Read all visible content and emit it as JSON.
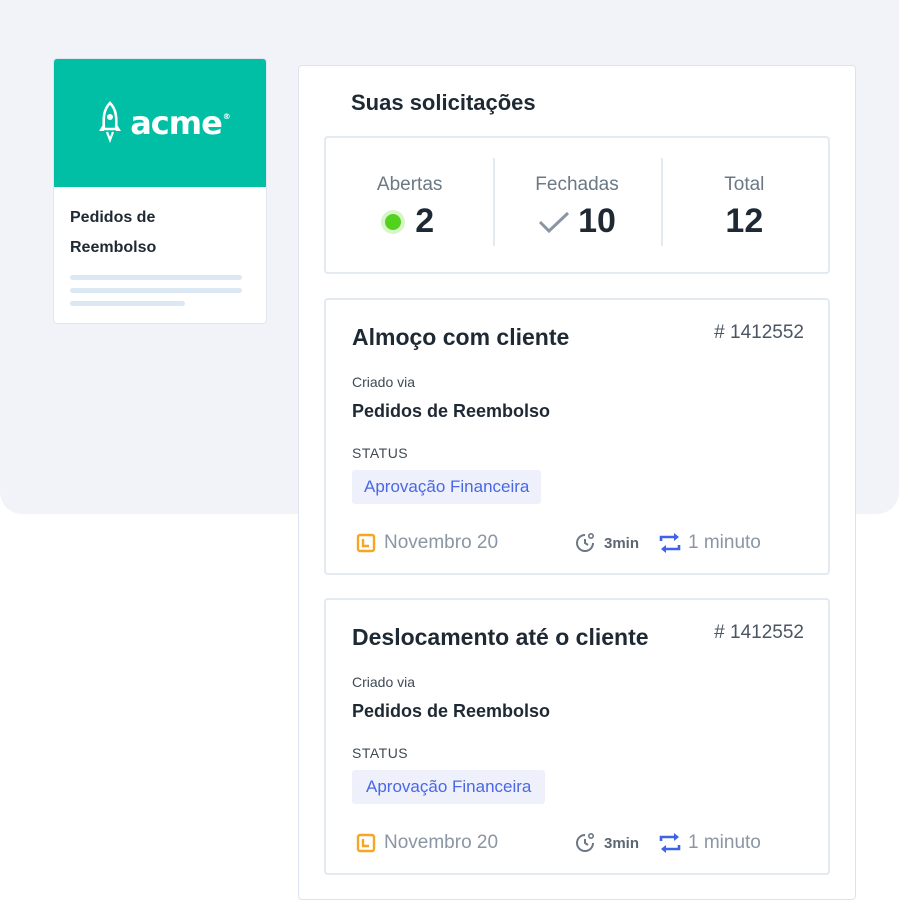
{
  "app_card": {
    "brand_name": "acme",
    "brand_mark": "®",
    "brand_color": "#00bfa5",
    "brand_icon": "rocket-icon",
    "title": "Pedidos de Reembolso"
  },
  "main": {
    "heading": "Suas solicitações",
    "stats": [
      {
        "label": "Abertas",
        "value": "2",
        "icon": "green-dot-icon"
      },
      {
        "label": "Fechadas",
        "value": "10",
        "icon": "checkmark-icon"
      },
      {
        "label": "Total",
        "value": "12"
      }
    ],
    "requests": [
      {
        "title": "Almoço com cliente",
        "id": "# 1412552",
        "via_label": "Criado via",
        "via": "Pedidos de Reembolso",
        "status_label": "STATUS",
        "status": "Aprovação Financeira",
        "date": "Novembro 20",
        "duration": "3min",
        "update": "1 minuto"
      },
      {
        "title": "Deslocamento até o cliente",
        "id": "# 1412552",
        "via_label": "Criado via",
        "via": "Pedidos de Reembolso",
        "status_label": "STATUS",
        "status": "Aprovação Financeira",
        "date": "Novembro 20",
        "duration": "3min",
        "update": "1 minuto"
      }
    ]
  },
  "colors": {
    "accent": "#00bfa5",
    "status_badge_bg": "#eef1fc",
    "status_badge_text": "#4b67e6",
    "open_dot": "#52d21c",
    "calendar_icon": "#f5a623",
    "sync_icon": "#3f62e8"
  }
}
